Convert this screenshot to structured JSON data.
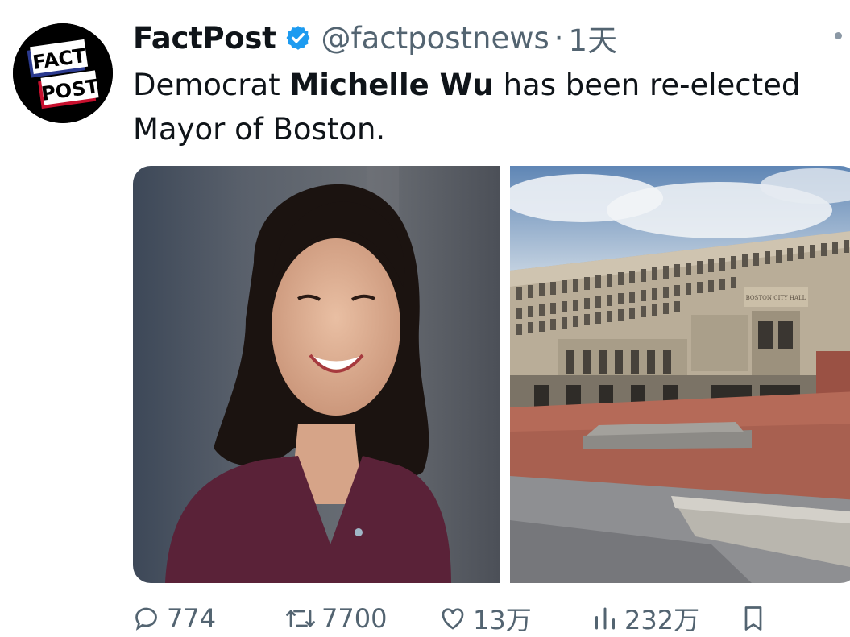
{
  "author": {
    "display_name": "FactPost",
    "handle": "@factpostnews",
    "separator": "·",
    "time": "1天",
    "avatar_text": [
      "FACT",
      "POST"
    ],
    "verified_color": "#1d9bf0"
  },
  "tweet": {
    "text_pre": "Democrat ",
    "text_bold": "Michelle Wu",
    "text_post": " has been re-elected Mayor of Boston."
  },
  "media": {
    "photo2_sign": "BOSTON CITY HALL"
  },
  "actions": {
    "reply_count": "774",
    "retweet_count": "7700",
    "like_count": "13万",
    "view_count": "232万"
  },
  "icons": [
    "verified-badge-icon",
    "more-icon",
    "reply-icon",
    "retweet-icon",
    "like-icon",
    "views-icon",
    "bookmark-icon"
  ]
}
